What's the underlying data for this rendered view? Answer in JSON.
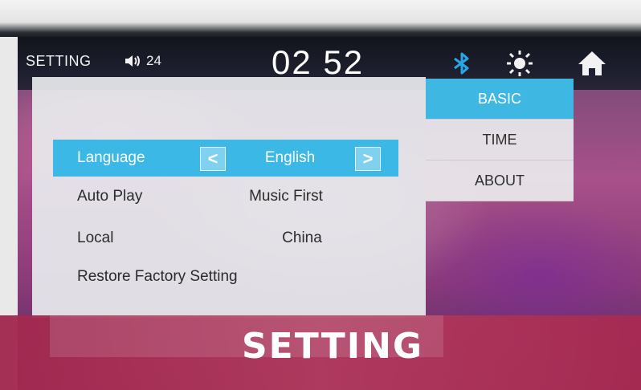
{
  "statusbar": {
    "title": "SETTING",
    "volume_level": "24",
    "clock": "02 52",
    "icons": [
      "volume-icon",
      "bluetooth-icon",
      "brightness-icon",
      "home-icon"
    ],
    "bluetooth_color": "#27a8e6"
  },
  "settings_list": {
    "rows": [
      {
        "label": "Language",
        "value": "English",
        "selected": true
      },
      {
        "label": "Auto Play",
        "value": "Music First",
        "selected": false
      },
      {
        "label": "Local",
        "value": "China",
        "selected": false
      },
      {
        "label": "Restore Factory Setting",
        "value": "",
        "selected": false
      }
    ],
    "prev_symbol": "<",
    "next_symbol": ">"
  },
  "side_tabs": {
    "items": [
      {
        "label": "BASIC",
        "active": true
      },
      {
        "label": "TIME",
        "active": false
      },
      {
        "label": "ABOUT",
        "active": false
      }
    ]
  },
  "banner": {
    "text": "SETTING",
    "color": "#a8284f"
  },
  "colors": {
    "accent": "#3bb8e6"
  }
}
